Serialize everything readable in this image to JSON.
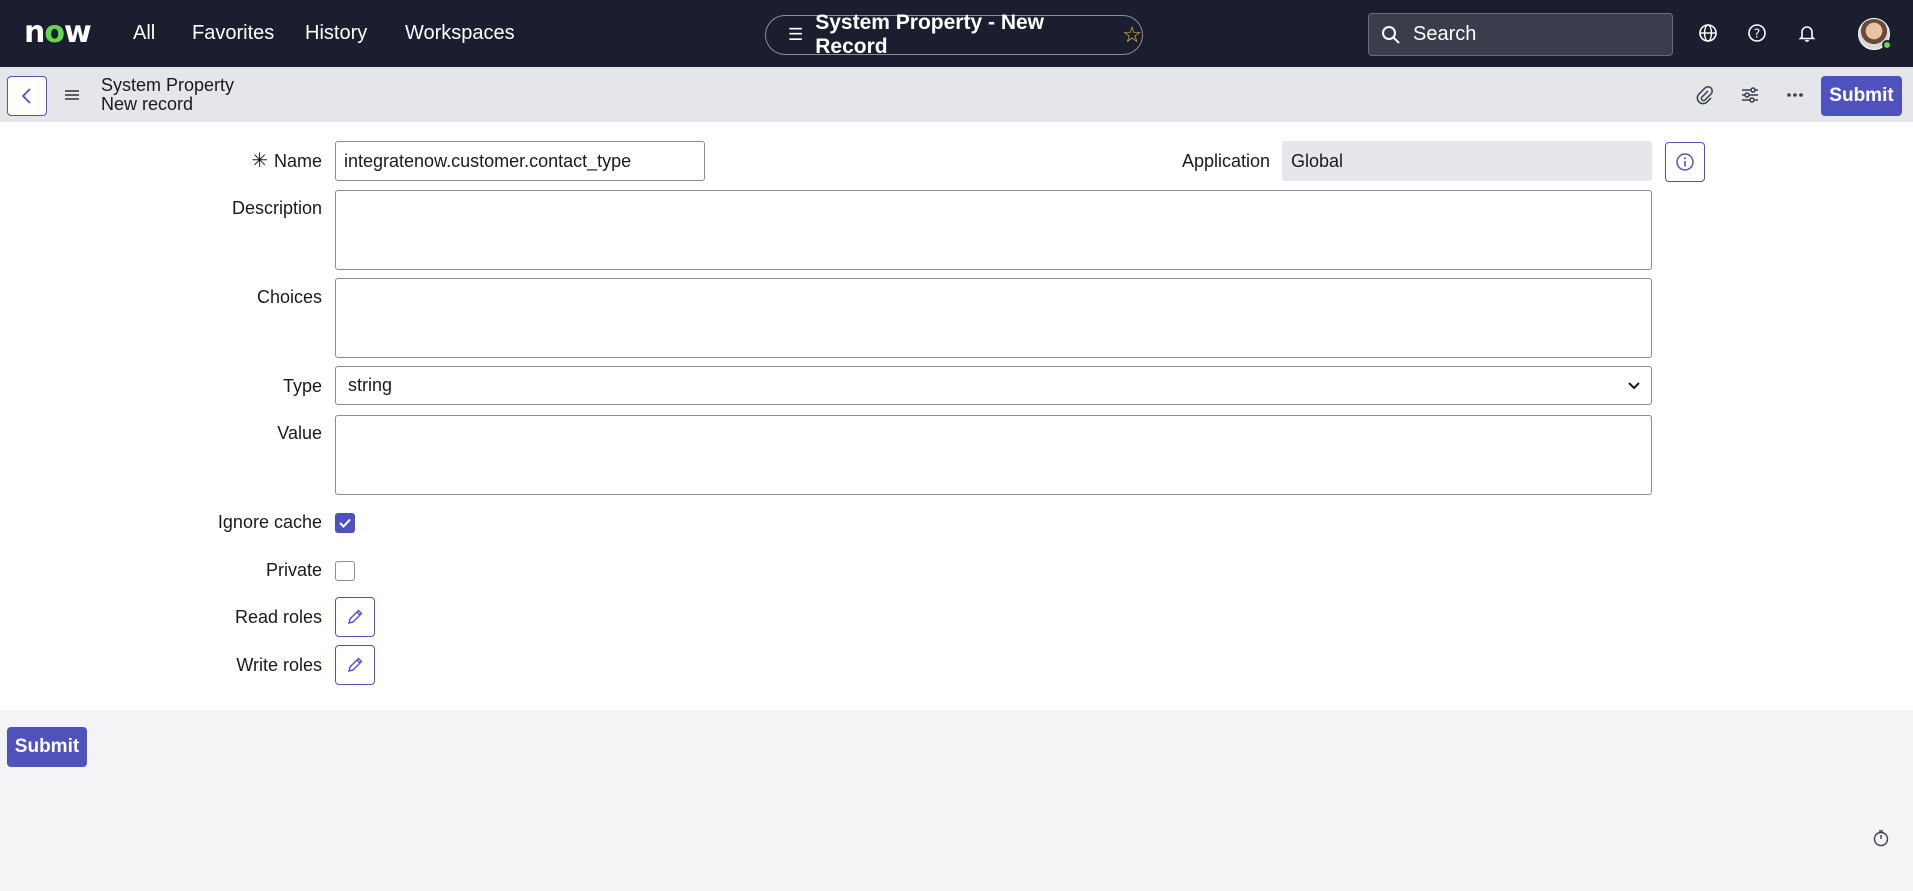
{
  "topnav": {
    "logo": {
      "prefix": "n",
      "o": "o",
      "suffix": "w"
    },
    "items": [
      {
        "label": "All"
      },
      {
        "label": "Favorites"
      },
      {
        "label": "History"
      },
      {
        "label": "Workspaces"
      }
    ],
    "record_title": "System Property - New Record",
    "search_placeholder": "Search",
    "icons": [
      "globe-icon",
      "help-icon",
      "bell-icon",
      "avatar"
    ]
  },
  "header": {
    "title_line1": "System Property",
    "title_line2": "New record",
    "icons": [
      "back-icon",
      "hamburger-icon",
      "paperclip-icon",
      "sliders-icon",
      "more-icon"
    ],
    "submit_label": "Submit"
  },
  "form": {
    "name_label": "Name",
    "name_value": "integratenow.customer.contact_type",
    "application_label": "Application",
    "application_value": "Global",
    "description_label": "Description",
    "description_value": "",
    "choices_label": "Choices",
    "choices_value": "",
    "type_label": "Type",
    "type_value": "string",
    "value_label": "Value",
    "value_value": "",
    "ignore_cache_label": "Ignore cache",
    "ignore_cache_checked": true,
    "private_label": "Private",
    "private_checked": false,
    "read_roles_label": "Read roles",
    "write_roles_label": "Write roles"
  },
  "footer": {
    "submit_label": "Submit"
  },
  "colors": {
    "topbar": "#1b1e2e",
    "accent": "#4f52bd",
    "logo_o": "#62d84e",
    "star": "#f3c14b"
  }
}
